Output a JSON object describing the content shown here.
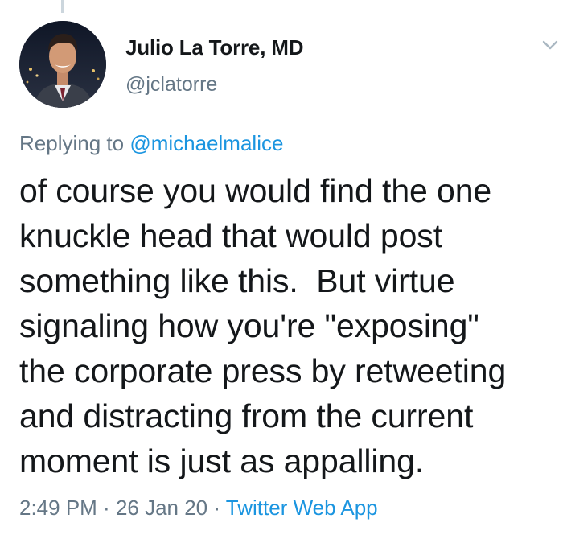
{
  "author": {
    "display_name": "Julio La Torre, MD",
    "handle": "@jclatorre"
  },
  "reply": {
    "prefix": "Replying to ",
    "mention": "@michaelmalice"
  },
  "tweet": {
    "text": "of course you would find the one\nknuckle head that would post\nsomething like this.  But virtue\nsignaling how you're \"exposing\"\nthe corporate press by retweeting\nand distracting from the current\nmoment is just as appalling."
  },
  "meta": {
    "time": "2:49 PM",
    "separator1": " · ",
    "date": "26 Jan 20",
    "separator2": " · ",
    "source": "Twitter Web App"
  },
  "icons": {
    "menu": "chevron-down-icon",
    "avatar": "profile-photo"
  },
  "colors": {
    "link": "#1b95e0",
    "secondary_text": "#657786",
    "primary_text": "#14171a",
    "thread_line": "#ccd6dd"
  }
}
